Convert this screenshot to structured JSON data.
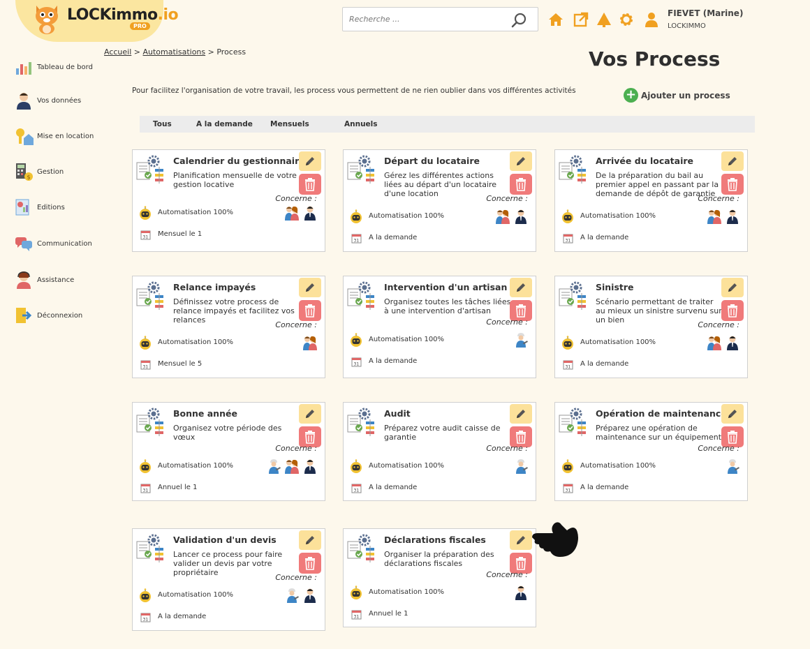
{
  "header": {
    "logo_main": "LOCKimmo",
    "logo_suffix": ".io",
    "logo_badge": "PRO",
    "search_placeholder": "Recherche ...",
    "user_name": "FIEVET (Marine)",
    "user_company": "LOCKIMMO",
    "icons": [
      "home-icon",
      "external-link-icon",
      "alert-icon",
      "gear-icon",
      "user-icon"
    ]
  },
  "sidebar": {
    "items": [
      {
        "label": "Tableau de bord",
        "icon": "dashboard-icon"
      },
      {
        "label": "Vos données",
        "icon": "person-icon"
      },
      {
        "label": "Mise en location",
        "icon": "key-house-icon"
      },
      {
        "label": "Gestion",
        "icon": "calculator-icon"
      },
      {
        "label": "Editions",
        "icon": "document-chart-icon"
      },
      {
        "label": "Communication",
        "icon": "chat-icon"
      },
      {
        "label": "Assistance",
        "icon": "support-agent-icon"
      },
      {
        "label": "Déconnexion",
        "icon": "logout-icon"
      }
    ]
  },
  "breadcrumb": {
    "home": "Accueil",
    "sep1": ">",
    "section": "Automatisations",
    "sep2": ">",
    "current": "Process"
  },
  "page_title": "Vos Process",
  "intro_text": "Pour facilitez l'organisation de votre travail, les process vous permettent de ne rien oublier dans vos différentes activités",
  "add_button_label": "Ajouter un process",
  "tabs": [
    "Tous",
    "A la demande",
    "Mensuels",
    "Annuels"
  ],
  "concerne_label": "Concerne :",
  "cards": [
    {
      "title": "Calendrier du gestionnaire",
      "description": "Planification mensuelle de votre gestion locative",
      "automation": "Automatisation 100%",
      "frequency": "Mensuel le 1",
      "concerns": [
        "couple",
        "man"
      ]
    },
    {
      "title": "Départ du locataire",
      "description": "Gérez les différentes actions liées au départ d'un locataire d'une location",
      "automation": "Automatisation 100%",
      "frequency": "A la demande",
      "concerns": [
        "couple",
        "man"
      ]
    },
    {
      "title": "Arrivée du locataire",
      "description": "De la préparation du bail au premier appel en passant par la demande de dépôt de garantie",
      "automation": "Automatisation 100%",
      "frequency": "A la demande",
      "concerns": [
        "couple",
        "man"
      ]
    },
    {
      "title": "Relance impayés",
      "description": "Définissez votre process de relance impayés et facilitez vos relances",
      "automation": "Automatisation 100%",
      "frequency": "Mensuel le 5",
      "concerns": [
        "couple"
      ]
    },
    {
      "title": "Intervention d'un artisan",
      "description": "Organisez toutes les tâches liées à une intervention d'artisan",
      "automation": "Automatisation 100%",
      "frequency": "A la demande",
      "concerns": [
        "worker"
      ]
    },
    {
      "title": "Sinistre",
      "description": "Scénario permettant de traiter au mieux un sinistre survenu sur un bien",
      "automation": "Automatisation 100%",
      "frequency": "A la demande",
      "concerns": [
        "couple",
        "man"
      ]
    },
    {
      "title": "Bonne année",
      "description": "Organisez votre période des vœux",
      "automation": "Automatisation 100%",
      "frequency": "Annuel le 1",
      "concerns": [
        "worker",
        "couple",
        "man"
      ]
    },
    {
      "title": "Audit",
      "description": "Préparez votre audit caisse de garantie",
      "automation": "Automatisation 100%",
      "frequency": "A la demande",
      "concerns": [
        "worker"
      ]
    },
    {
      "title": "Opération de maintenance",
      "description": "Préparez une opération de maintenance sur un équipement",
      "automation": "Automatisation 100%",
      "frequency": "A la demande",
      "concerns": [
        "worker"
      ]
    },
    {
      "title": "Validation d'un devis",
      "description": "Lancer ce process pour faire valider un devis par votre propriétaire",
      "automation": "Automatisation 100%",
      "frequency": "A la demande",
      "concerns": [
        "worker",
        "man"
      ]
    },
    {
      "title": "Déclarations fiscales",
      "description": "Organiser la préparation des déclarations fiscales",
      "automation": "Automatisation 100%",
      "frequency": "Annuel le 1",
      "concerns": [
        "man"
      ]
    }
  ],
  "colors": {
    "background": "#fdf8ec",
    "accent_orange": "#f0a020",
    "edit_button": "#fce19a",
    "delete_button": "#f07a7a",
    "add_green": "#4caf50"
  }
}
